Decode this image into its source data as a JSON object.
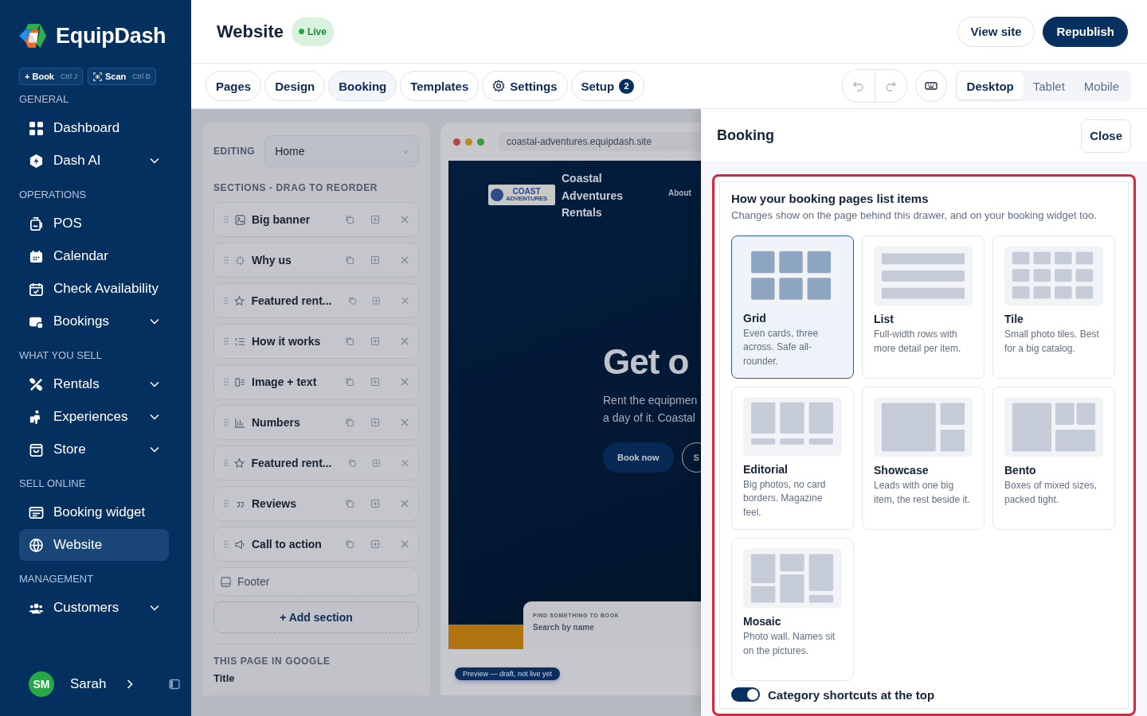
{
  "brand": {
    "name": "EquipDash"
  },
  "quick_actions": [
    {
      "label": "+ Book",
      "shortcut": "Ctrl J",
      "kind": "plain"
    },
    {
      "label": "Scan",
      "shortcut": "Ctrl B",
      "kind": "scan"
    }
  ],
  "nav_groups": [
    {
      "heading": "GENERAL",
      "items": [
        {
          "kind": "dashboard",
          "label": "Dashboard",
          "expandable": false,
          "selected": false
        },
        {
          "kind": "ai",
          "label": "Dash AI",
          "expandable": true,
          "selected": false
        }
      ]
    },
    {
      "heading": "OPERATIONS",
      "items": [
        {
          "kind": "pos",
          "label": "POS",
          "expandable": false,
          "selected": false
        },
        {
          "kind": "calendar",
          "label": "Calendar",
          "expandable": false,
          "selected": false
        },
        {
          "kind": "calendar-check",
          "label": "Check Availability",
          "expandable": false,
          "selected": false
        },
        {
          "kind": "bookings",
          "label": "Bookings",
          "expandable": true,
          "selected": false
        }
      ]
    },
    {
      "heading": "WHAT YOU SELL",
      "items": [
        {
          "kind": "rentals",
          "label": "Rentals",
          "expandable": true,
          "selected": false
        },
        {
          "kind": "experiences",
          "label": "Experiences",
          "expandable": true,
          "selected": false
        },
        {
          "kind": "store",
          "label": "Store",
          "expandable": true,
          "selected": false
        }
      ]
    },
    {
      "heading": "SELL ONLINE",
      "items": [
        {
          "kind": "widget",
          "label": "Booking widget",
          "expandable": false,
          "selected": false
        },
        {
          "kind": "globe",
          "label": "Website",
          "expandable": false,
          "selected": true
        }
      ]
    },
    {
      "heading": "MANAGEMENT",
      "items": [
        {
          "kind": "people",
          "label": "Customers",
          "expandable": true,
          "selected": false
        }
      ]
    }
  ],
  "user": {
    "initials": "SM",
    "name": "Sarah"
  },
  "page_header": {
    "title": "Website",
    "status": "Live",
    "actions": [
      {
        "label": "View site",
        "kind": "outline"
      },
      {
        "label": "Republish",
        "kind": "primary"
      }
    ]
  },
  "tabs": [
    {
      "label": "Pages",
      "kind": "plain",
      "selected": false
    },
    {
      "label": "Design",
      "kind": "plain",
      "selected": false
    },
    {
      "label": "Booking",
      "kind": "plain",
      "selected": true
    },
    {
      "label": "Templates",
      "kind": "plain",
      "selected": false
    },
    {
      "label": "Settings",
      "kind": "gear",
      "selected": false
    },
    {
      "label": "Setup",
      "kind": "plain",
      "badge": "2",
      "selected": false
    }
  ],
  "devices": [
    {
      "label": "Desktop",
      "selected": true
    },
    {
      "label": "Tablet",
      "selected": false
    },
    {
      "label": "Mobile",
      "selected": false
    }
  ],
  "editor": {
    "editing_label": "EDITING",
    "page": "Home",
    "sections_heading": "SECTIONS - DRAG TO REORDER",
    "sections": [
      {
        "kind": "image",
        "movable": true,
        "label": "Big banner"
      },
      {
        "kind": "sparkle",
        "movable": true,
        "label": "Why us"
      },
      {
        "kind": "star",
        "movable": true,
        "label": "Featured rent..."
      },
      {
        "kind": "numbered-list",
        "movable": true,
        "label": "How it works"
      },
      {
        "kind": "image-text",
        "movable": true,
        "label": "Image + text"
      },
      {
        "kind": "bar-chart",
        "movable": true,
        "label": "Numbers"
      },
      {
        "kind": "star",
        "movable": true,
        "label": "Featured rent..."
      },
      {
        "kind": "quote",
        "movable": true,
        "label": "Reviews"
      },
      {
        "kind": "megaphone",
        "movable": true,
        "label": "Call to action"
      },
      {
        "kind": "footer",
        "movable": false,
        "label": "Footer"
      }
    ],
    "add_button": "+ Add section",
    "seo_heading": "THIS PAGE IN GOOGLE",
    "seo_title_label": "Title"
  },
  "preview": {
    "url": "coastal-adventures.equipdash.site",
    "logo_lines": [
      "COAST",
      "ADVENTURES"
    ],
    "site_name": "Coastal Adventures Rentals",
    "nav": [
      "About"
    ],
    "headline": "Get o",
    "lead_lines": [
      "Rent the equipmen",
      "a day of it. Coastal"
    ],
    "buttons": [
      {
        "label": "Book now",
        "kind": "solid"
      },
      {
        "label": "S",
        "kind": "outline"
      }
    ],
    "search_label": "FIND SOMETHING TO BOOK",
    "search_placeholder": "Search by name",
    "badge": "Preview — draft, not live yet"
  },
  "drawer": {
    "title": "Booking",
    "close": "Close",
    "section": {
      "highlighted": true,
      "title": "How your booking pages list items",
      "description": "Changes show on the page behind this drawer, and on your booking widget too.",
      "layouts": [
        {
          "kind": "grid",
          "name": "Grid",
          "description": "Even cards, three across. Safe all-rounder.",
          "selected": true
        },
        {
          "kind": "list",
          "name": "List",
          "description": "Full-width rows with more detail per item.",
          "selected": false
        },
        {
          "kind": "tile",
          "name": "Tile",
          "description": "Small photo tiles. Best for a big catalog.",
          "selected": false
        },
        {
          "kind": "editorial",
          "name": "Editorial",
          "description": "Big photos, no card borders. Magazine feel.",
          "selected": false
        },
        {
          "kind": "showcase",
          "name": "Showcase",
          "description": "Leads with one big item, the rest beside it.",
          "selected": false
        },
        {
          "kind": "bento",
          "name": "Bento",
          "description": "Boxes of mixed sizes, packed tight.",
          "selected": false
        },
        {
          "kind": "mosaic",
          "name": "Mosaic",
          "description": "Photo wall. Names sit on the pictures.",
          "selected": false
        }
      ],
      "toggles": [
        {
          "label": "Category shortcuts at the top",
          "on": true
        }
      ]
    }
  }
}
